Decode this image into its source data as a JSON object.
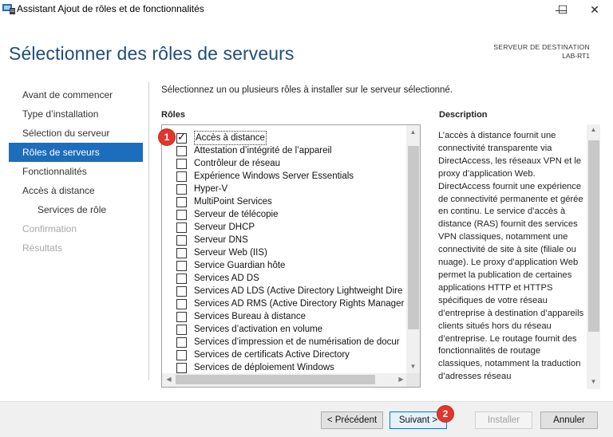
{
  "window": {
    "title": "Assistant Ajout de rôles et de fonctionnalités",
    "min_glyph": "—",
    "max_glyph": "☐",
    "close_glyph": "✕"
  },
  "header": {
    "page_title": "Sélectionner des rôles de serveurs",
    "destination_label": "SERVEUR DE DESTINATION",
    "destination_value": "LAB-RT1"
  },
  "nav": {
    "items": [
      {
        "label": "Avant de commencer"
      },
      {
        "label": "Type d’installation"
      },
      {
        "label": "Sélection du serveur"
      },
      {
        "label": "Rôles de serveurs",
        "state": "active"
      },
      {
        "label": "Fonctionnalités"
      },
      {
        "label": "Accès à distance"
      },
      {
        "label": "Services de rôle"
      },
      {
        "label": "Confirmation",
        "state": "disabled"
      },
      {
        "label": "Résultats",
        "state": "disabled"
      }
    ]
  },
  "main": {
    "intro": "Sélectionnez un ou plusieurs rôles à installer sur le serveur sélectionné.",
    "roles_heading": "Rôles",
    "description_heading": "Description",
    "roles": [
      {
        "label": "Accès à distance",
        "checked": true
      },
      {
        "label": "Attestation d’intégrité de l’appareil",
        "checked": false
      },
      {
        "label": "Contrôleur de réseau",
        "checked": false
      },
      {
        "label": "Expérience Windows Server Essentials",
        "checked": false
      },
      {
        "label": "Hyper-V",
        "checked": false
      },
      {
        "label": "MultiPoint Services",
        "checked": false
      },
      {
        "label": "Serveur de télécopie",
        "checked": false
      },
      {
        "label": "Serveur DHCP",
        "checked": false
      },
      {
        "label": "Serveur DNS",
        "checked": false
      },
      {
        "label": "Serveur Web (IIS)",
        "checked": false
      },
      {
        "label": "Service Guardian hôte",
        "checked": false
      },
      {
        "label": "Services AD DS",
        "checked": false
      },
      {
        "label": "Services AD LDS (Active Directory Lightweight Dire",
        "checked": false
      },
      {
        "label": "Services AD RMS (Active Directory Rights Manager",
        "checked": false
      },
      {
        "label": "Services Bureau à distance",
        "checked": false
      },
      {
        "label": "Services d’activation en volume",
        "checked": false
      },
      {
        "label": "Services d’impression et de numérisation de docur",
        "checked": false
      },
      {
        "label": "Services de certificats Active Directory",
        "checked": false
      },
      {
        "label": "Services de déploiement Windows",
        "checked": false
      }
    ],
    "description": "L’accès à distance fournit une connectivité transparente via DirectAccess, les réseaux VPN et le proxy d’application Web. DirectAccess fournit une expérience de connectivité permanente et gérée en continu. Le service d’accès à distance (RAS) fournit des services VPN classiques, notamment une connectivité de site à site (filiale ou nuage). Le proxy d’application Web permet la publication de certaines applications HTTP et HTTPS spécifiques de votre réseau d’entreprise à destination d’appareils clients situés hors du réseau d’entreprise. Le routage fournit des fonctionnalités de routage classiques, notamment la traduction d’adresses réseau"
  },
  "footer": {
    "previous_label": "< Précédent",
    "next_label": "Suivant >",
    "install_label": "Installer",
    "cancel_label": "Annuler"
  },
  "markers": {
    "one": "1",
    "two": "2"
  },
  "colors": {
    "title_blue": "#1f4e79",
    "active_nav": "#1c6dbb",
    "marker_red": "#e0362c"
  }
}
